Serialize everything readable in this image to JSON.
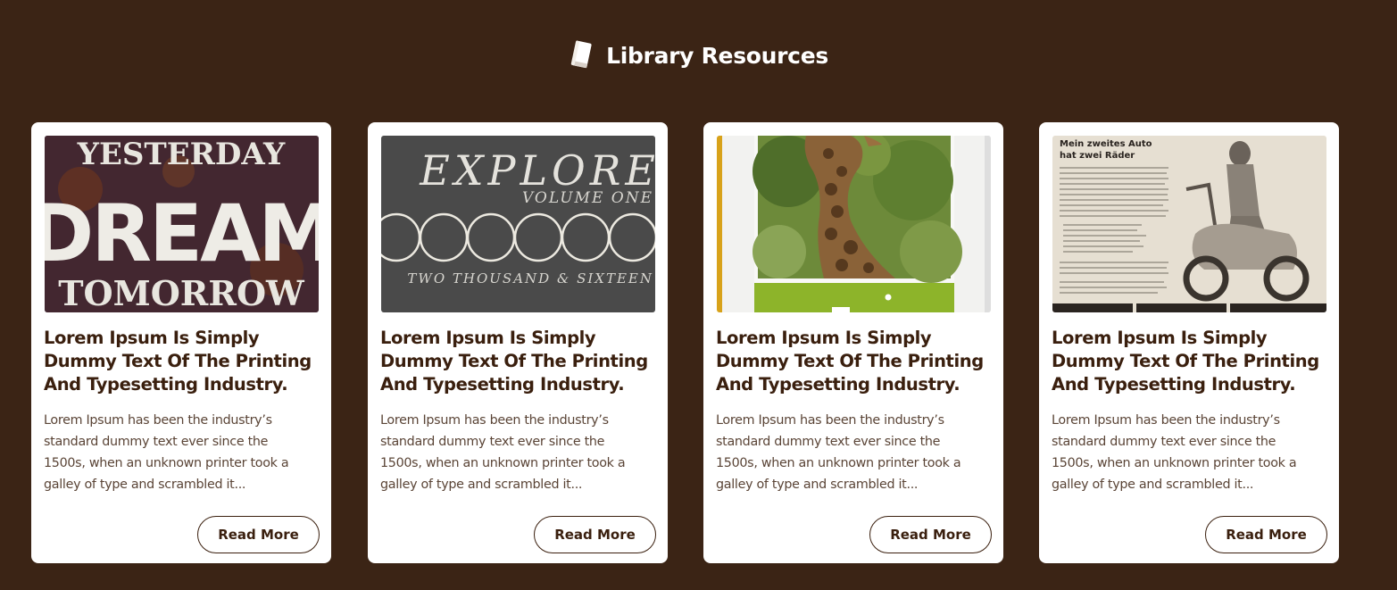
{
  "section": {
    "title": "Library Resources",
    "icon": "book-icon"
  },
  "cards": [
    {
      "image_icon": "vintage-dream-sign-image",
      "image_text": [
        "YESTERDAY",
        "DREAM",
        "TOMORROW"
      ],
      "title": "Lorem Ipsum Is Simply Dummy Text Of The Printing And Typesetting Industry.",
      "description": "Lorem Ipsum has been the industry’s standard dummy text ever since the 1500s, when an unknown printer took a galley of type and scrambled it...",
      "button_label": "Read More"
    },
    {
      "image_icon": "explore-volume-cover-image",
      "image_text": [
        "EXPLORE",
        "VOLUME ONE",
        "TWO THOUSAND & SIXTEEN"
      ],
      "title": "Lorem Ipsum Is Simply Dummy Text Of The Printing And Typesetting Industry.",
      "description": "Lorem Ipsum has been the industry’s standard dummy text ever since the 1500s, when an unknown printer took a galley of type and scrambled it...",
      "button_label": "Read More"
    },
    {
      "image_icon": "giraffe-photo-image",
      "title": "Lorem Ipsum Is Simply Dummy Text Of The Printing And Typesetting Industry.",
      "description": "Lorem Ipsum has been the industry’s standard dummy text ever since the 1500s, when an unknown printer took a galley of type and scrambled it...",
      "button_label": "Read More"
    },
    {
      "image_icon": "vintage-scooter-ad-image",
      "image_text": [
        "Mein zweites Auto",
        "hat zwei Räder"
      ],
      "title": "Lorem Ipsum Is Simply Dummy Text Of The Printing And Typesetting Industry.",
      "description": "Lorem Ipsum has been the industry’s standard dummy text ever since the 1500s, when an unknown printer took a galley of type and scrambled it...",
      "button_label": "Read More"
    }
  ],
  "colors": {
    "background": "#3b2415",
    "card": "#ffffff",
    "text_dark": "#3a1f0e",
    "text_body": "#5a4436",
    "accent_green": "#8db42a"
  }
}
